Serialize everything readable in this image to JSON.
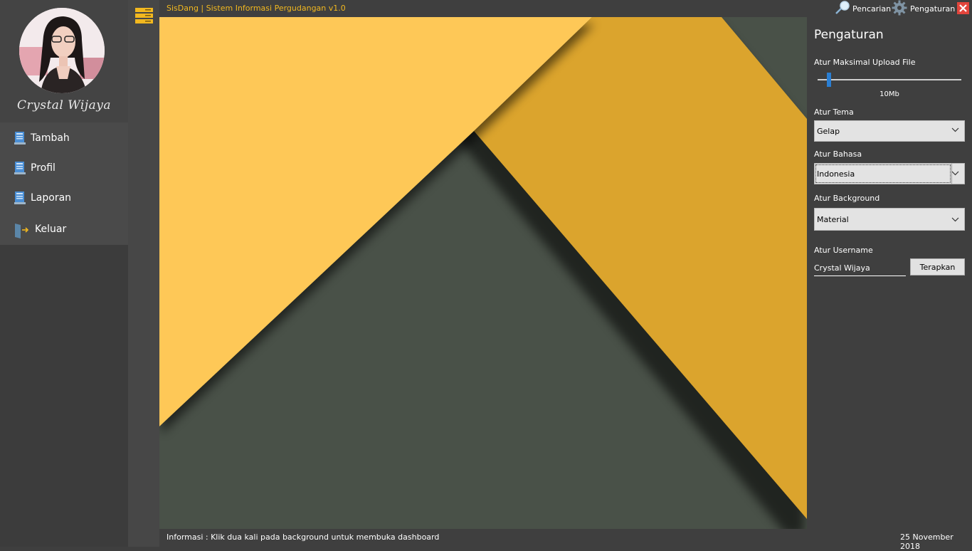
{
  "app_title": "SisDang | Sistem Informasi Pergudangan v1.0",
  "user": {
    "name": "Crystal Wijaya"
  },
  "menu": {
    "items": [
      {
        "label": "Tambah",
        "icon": "book-icon"
      },
      {
        "label": "Profil",
        "icon": "book-icon"
      },
      {
        "label": "Laporan",
        "icon": "book-icon"
      },
      {
        "label": "Keluar",
        "icon": "logout-door-icon"
      }
    ]
  },
  "topbar": {
    "search_label": "Pencarian",
    "settings_label": "Pengaturan"
  },
  "settings": {
    "title": "Pengaturan",
    "upload_label": "Atur Maksimal Upload File",
    "upload_value": "10Mb",
    "upload_level": 0.08,
    "theme_label": "Atur Tema",
    "theme_value": "Gelap",
    "language_label": "Atur Bahasa",
    "language_value": "Indonesia",
    "background_label": "Atur Background",
    "background_value": "Material",
    "username_label": "Atur Username",
    "username_value": "Crystal Wijaya",
    "apply_label": "Terapkan"
  },
  "status": {
    "info": "Informasi : Klik dua kali pada background untuk membuka dashboard",
    "date": "25 November 2018"
  },
  "colors": {
    "accent": "#f2b81f",
    "close": "#e2453c",
    "slider": "#2a7fd4",
    "material_yellow": "#fec857",
    "material_orange": "#dba42d",
    "material_gray": "#4d554b"
  }
}
